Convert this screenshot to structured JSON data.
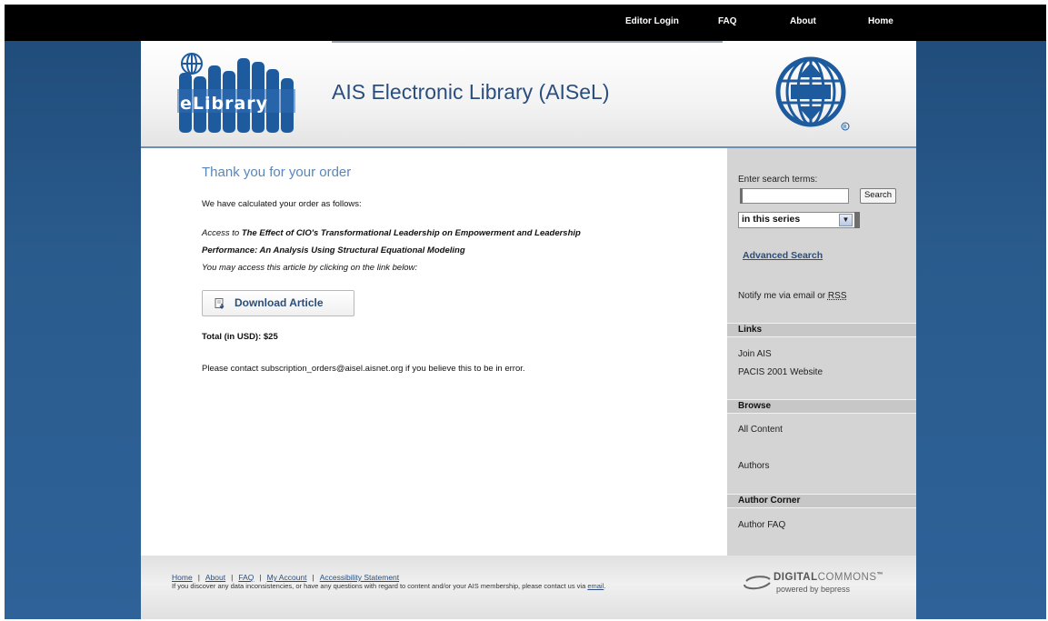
{
  "topnav": {
    "editor_login": "Editor Login",
    "faq": "FAQ",
    "about": "About",
    "home": "Home"
  },
  "header": {
    "logo_text": "eLibrary",
    "title": "AIS Electronic Library (AISeL)"
  },
  "main": {
    "heading": "Thank you for your order",
    "calc_text": "We have calculated your order as follows:",
    "access_prefix": "Access to ",
    "article_title_line1": "The Effect of CIO's Transformational Leadership on Empowerment and Leadership",
    "article_title_line2": "Performance: An Analysis Using Structural Equational Modeling",
    "may_access_text": "You may access this article by clicking on the link below:",
    "download_label": "Download Article",
    "total_text": "Total (in USD): $25",
    "contact_text": "Please contact subscription_orders@aisel.aisnet.org if you believe this to be in error."
  },
  "sidebar": {
    "search_label": "Enter search terms:",
    "search_value": "",
    "search_button": "Search",
    "scope_selected": "in this series",
    "advanced_search": "Advanced Search",
    "notify_prefix": "Notify me via email or ",
    "notify_rss": "RSS",
    "links_heading": "Links",
    "links": [
      "Join AIS",
      "PACIS 2001 Website"
    ],
    "browse_heading": "Browse",
    "browse": [
      "All Content",
      "Authors"
    ],
    "author_corner_heading": "Author Corner",
    "author_corner": [
      "Author FAQ"
    ]
  },
  "footer": {
    "links": [
      "Home",
      "About",
      "FAQ",
      "My Account",
      "Accessibility Statement"
    ],
    "separator": "|",
    "note_prefix": "If you discover any data inconsistencies, or have any questions with regard to content and/or your AIS membership, please contact us via ",
    "note_link": "email",
    "note_suffix": ".",
    "dc_bold": "DIGITAL",
    "dc_light": "COMMONS",
    "dc_tm": "™",
    "dc_sub": "powered by bepress"
  },
  "colors": {
    "brand_blue": "#2a4e7e",
    "heading_blue": "#5a87b8",
    "background_blue": "#2a5b8d",
    "sidebar_gray": "#d4d4d4"
  }
}
